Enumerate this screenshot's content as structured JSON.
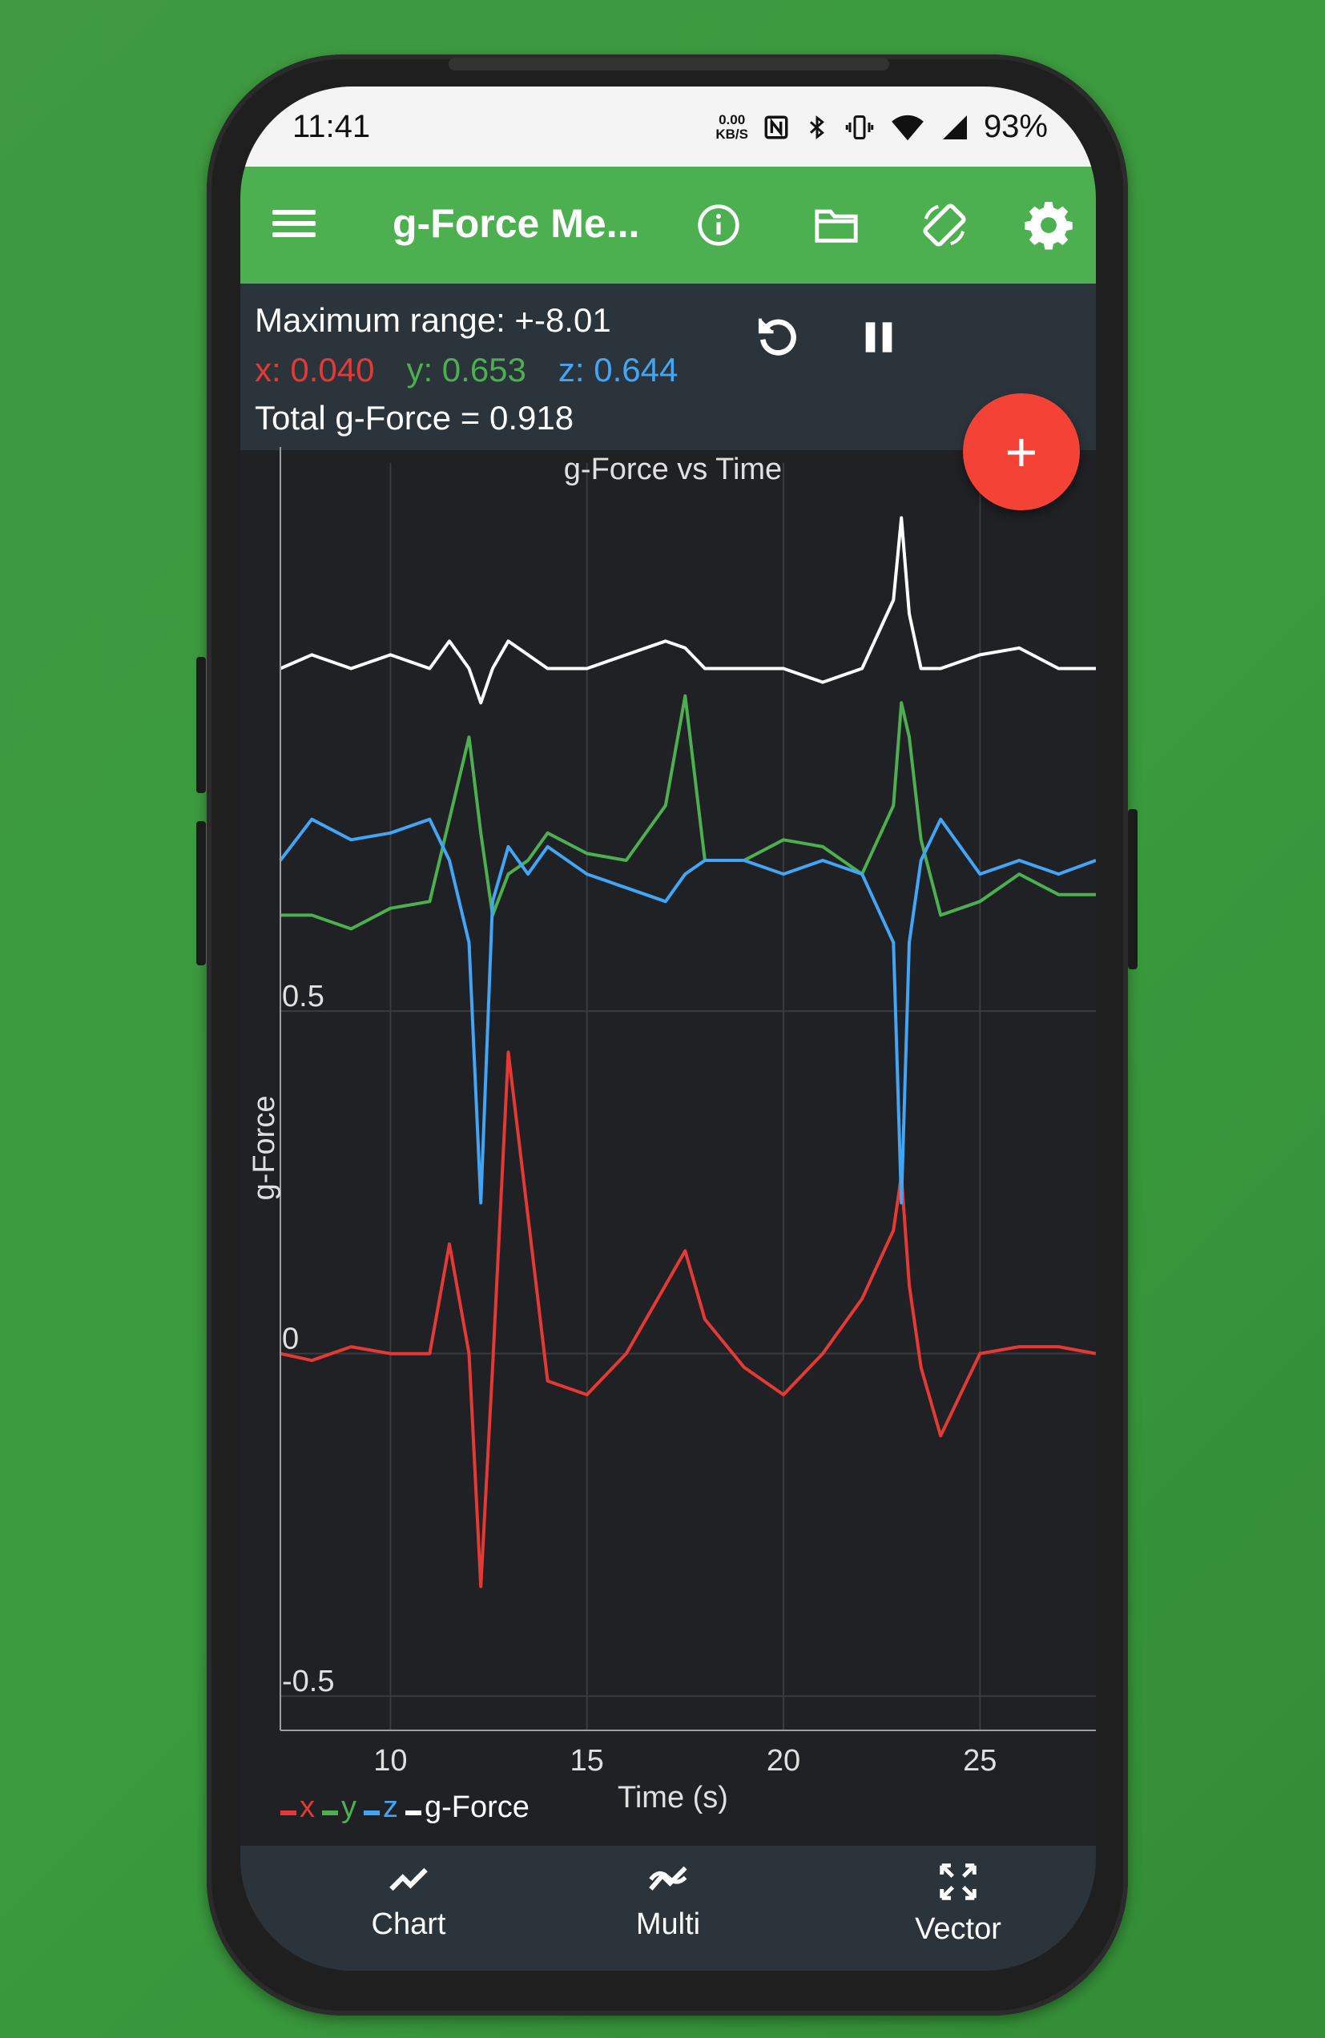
{
  "status_bar": {
    "time": "11:41",
    "net_speed_value": "0.00",
    "net_speed_unit": "KB/S",
    "battery": "93%",
    "icons": [
      "nfc-icon",
      "bluetooth-icon",
      "vibrate-icon",
      "wifi-icon",
      "cell-signal-icon"
    ]
  },
  "app_bar": {
    "title": "g-Force Me...",
    "actions": [
      "info-icon",
      "folder-icon",
      "screen-rotation-icon",
      "gear-icon"
    ]
  },
  "info_panel": {
    "max_range": "Maximum range: +-8.01",
    "x_reading": "x: 0.040",
    "y_reading": "y: 0.653",
    "z_reading": "z: 0.644",
    "total": "Total g-Force = 0.918",
    "actions": [
      "reset-icon",
      "pause-icon"
    ]
  },
  "fab_label": "+",
  "colors": {
    "app_green": "#4caf50",
    "panel": "#2b343b",
    "chart_bg": "#202124",
    "x": "#e53935",
    "y": "#4caf50",
    "z": "#42a5f5",
    "g": "#ffffff",
    "fab": "#f44336"
  },
  "chart_data": {
    "type": "line",
    "title": "g-Force vs Time",
    "xlabel": "Time (s)",
    "ylabel": "g-Force",
    "xlim": [
      7.2,
      27.95
    ],
    "ylim": [
      -0.55,
      1.3
    ],
    "xticks": [
      10,
      15,
      20,
      25
    ],
    "yticks": [
      -0.5,
      0,
      0.5
    ],
    "grid": true,
    "legend_position": "bottom-left",
    "x": [
      7.2,
      8.0,
      9.0,
      10.0,
      11.0,
      11.5,
      12.0,
      12.3,
      12.6,
      13.0,
      13.5,
      14.0,
      15.0,
      16.0,
      17.0,
      17.5,
      18.0,
      19.0,
      20.0,
      21.0,
      22.0,
      22.8,
      23.0,
      23.2,
      23.5,
      24.0,
      25.0,
      26.0,
      27.0,
      27.95
    ],
    "series": [
      {
        "name": "x",
        "values": [
          0.0,
          -0.01,
          0.01,
          0.0,
          0.0,
          0.16,
          0.0,
          -0.34,
          -0.02,
          0.44,
          0.2,
          -0.04,
          -0.06,
          0.0,
          0.1,
          0.15,
          0.05,
          -0.02,
          -0.06,
          0.0,
          0.08,
          0.18,
          0.26,
          0.1,
          -0.02,
          -0.12,
          0.0,
          0.01,
          0.01,
          0.0
        ]
      },
      {
        "name": "y",
        "values": [
          0.64,
          0.64,
          0.62,
          0.65,
          0.66,
          0.78,
          0.9,
          0.76,
          0.64,
          0.7,
          0.72,
          0.76,
          0.73,
          0.72,
          0.8,
          0.96,
          0.72,
          0.72,
          0.75,
          0.74,
          0.7,
          0.8,
          0.95,
          0.9,
          0.75,
          0.64,
          0.66,
          0.7,
          0.67,
          0.67
        ]
      },
      {
        "name": "z",
        "values": [
          0.72,
          0.78,
          0.75,
          0.76,
          0.78,
          0.72,
          0.6,
          0.22,
          0.66,
          0.74,
          0.7,
          0.74,
          0.7,
          0.68,
          0.66,
          0.7,
          0.72,
          0.72,
          0.7,
          0.72,
          0.7,
          0.6,
          0.22,
          0.6,
          0.72,
          0.78,
          0.7,
          0.72,
          0.7,
          0.72
        ]
      },
      {
        "name": "g-Force",
        "values": [
          1.0,
          1.02,
          1.0,
          1.02,
          1.0,
          1.04,
          1.0,
          0.95,
          1.0,
          1.04,
          1.02,
          1.0,
          1.0,
          1.02,
          1.04,
          1.03,
          1.0,
          1.0,
          1.0,
          0.98,
          1.0,
          1.1,
          1.22,
          1.08,
          1.0,
          1.0,
          1.02,
          1.03,
          1.0,
          1.0
        ]
      }
    ]
  },
  "bottom_nav": {
    "chart_label": "Chart",
    "multi_label": "Multi",
    "vector_label": "Vector"
  }
}
